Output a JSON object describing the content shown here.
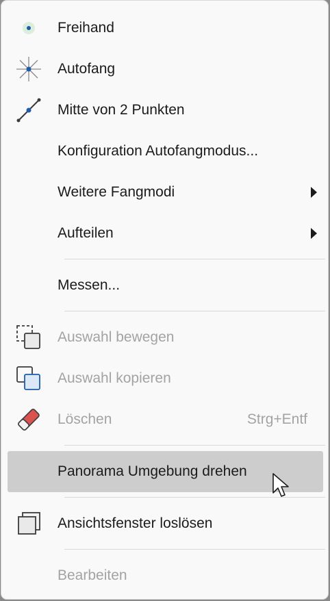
{
  "menu": {
    "items": [
      {
        "label": "Freihand",
        "icon": "freehand-dot-icon"
      },
      {
        "label": "Autofang",
        "icon": "snap-star-icon"
      },
      {
        "label": "Mitte von 2 Punkten",
        "icon": "midpoint-line-icon"
      },
      {
        "label": "Konfiguration Autofangmodus..."
      },
      {
        "label": "Weitere Fangmodi",
        "submenu": true
      },
      {
        "label": "Aufteilen",
        "submenu": true
      },
      {
        "label": "Messen..."
      },
      {
        "label": "Auswahl bewegen",
        "icon": "move-selection-icon",
        "disabled": true
      },
      {
        "label": "Auswahl kopieren",
        "icon": "copy-selection-icon",
        "disabled": true
      },
      {
        "label": "Löschen",
        "icon": "eraser-icon",
        "shortcut": "Strg+Entf",
        "disabled": true
      },
      {
        "label": "Panorama Umgebung drehen",
        "highlighted": true
      },
      {
        "label": "Ansichtsfenster loslösen",
        "icon": "detach-viewport-icon"
      },
      {
        "label": "Bearbeiten",
        "disabled": true
      }
    ]
  },
  "colors": {
    "menu_bg": "#f9f9f9",
    "highlight": "#cdcdcd",
    "text": "#1b1b1b",
    "disabled_text": "#a3a3a3",
    "icon_blue": "#1f5ba8",
    "eraser_red": "#d9534f"
  }
}
